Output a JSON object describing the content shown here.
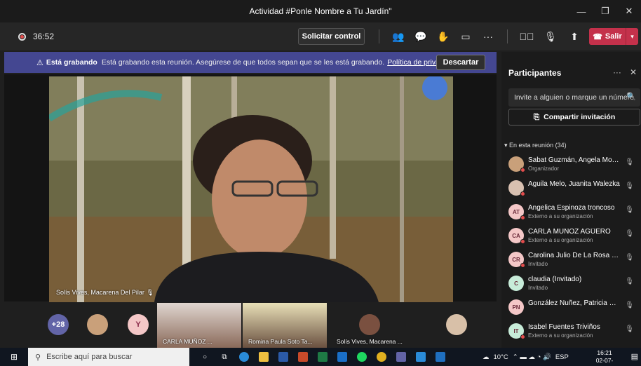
{
  "window": {
    "title": "Actividad #Ponle Nombre a Tu Jardín\""
  },
  "toolbar": {
    "timer": "36:52",
    "request_control": "Solicitar control",
    "leave_label": "Salir"
  },
  "banner": {
    "bold": "Está grabando",
    "message": "Está grabando esta reunión. Asegúrese de que todos sepan que se les está grabando.",
    "link": "Política de privacidad",
    "discard": "Descartar"
  },
  "main_video": {
    "name": "Solís Vives, Macarena Del Pilar"
  },
  "thumbnails": {
    "overflow_count": "+28",
    "initial_y": "Y",
    "video1_name": "CARLA MUÑOZ ...",
    "video2_name": "Romina Paula Soto Ta...",
    "video3_name": "Solís Vives, Macarena ..."
  },
  "panel": {
    "title": "Participantes",
    "invite_placeholder": "Invite a alguien o marque un número",
    "share": "Compartir invitación",
    "section": "En esta reunión (34)",
    "participants": [
      {
        "initials": "",
        "name": "Sabat Guzmán, Angela Morella",
        "sub": "Organizador",
        "color": "#c9a07a",
        "status": "#e34d4d"
      },
      {
        "initials": "",
        "name": "Aguila Melo, Juanita Walezka",
        "sub": "",
        "color": "#d8c0b0",
        "status": "#e34d4d"
      },
      {
        "initials": "AT",
        "name": "Angelica Espinoza troncoso",
        "sub": "Externo a su organización",
        "color": "#f4c7c7",
        "status": "#e34d4d"
      },
      {
        "initials": "CA",
        "name": "CARLA MUÑOZ AGÜERO",
        "sub": "Externo a su organización",
        "color": "#f4c7c7",
        "status": "#e34d4d"
      },
      {
        "initials": "CR",
        "name": "Carolina Julio De La Rosa (Invi...",
        "sub": "Invitado",
        "color": "#f4c7c7",
        "status": "#e34d4d"
      },
      {
        "initials": "C",
        "name": "claudia (Invitado)",
        "sub": "Invitado",
        "color": "#c7ecd9",
        "status": ""
      },
      {
        "initials": "PN",
        "name": "González Nuñez, Patricia Paola",
        "sub": "",
        "color": "#f4c7c7",
        "status": ""
      },
      {
        "initials": "IT",
        "name": "Isabel Fuentes Triviños",
        "sub": "Externo a su organización",
        "color": "#c7ecd9",
        "status": "#e34d4d"
      }
    ]
  },
  "taskbar": {
    "search_placeholder": "Escribe aquí para buscar",
    "weather": "10°C",
    "lang": "ESP",
    "time": "16:21",
    "date": "02-07-2021"
  },
  "colors": {
    "accent": "#444791",
    "leave": "#c4314b",
    "panel_bg": "#1b1b1b"
  }
}
